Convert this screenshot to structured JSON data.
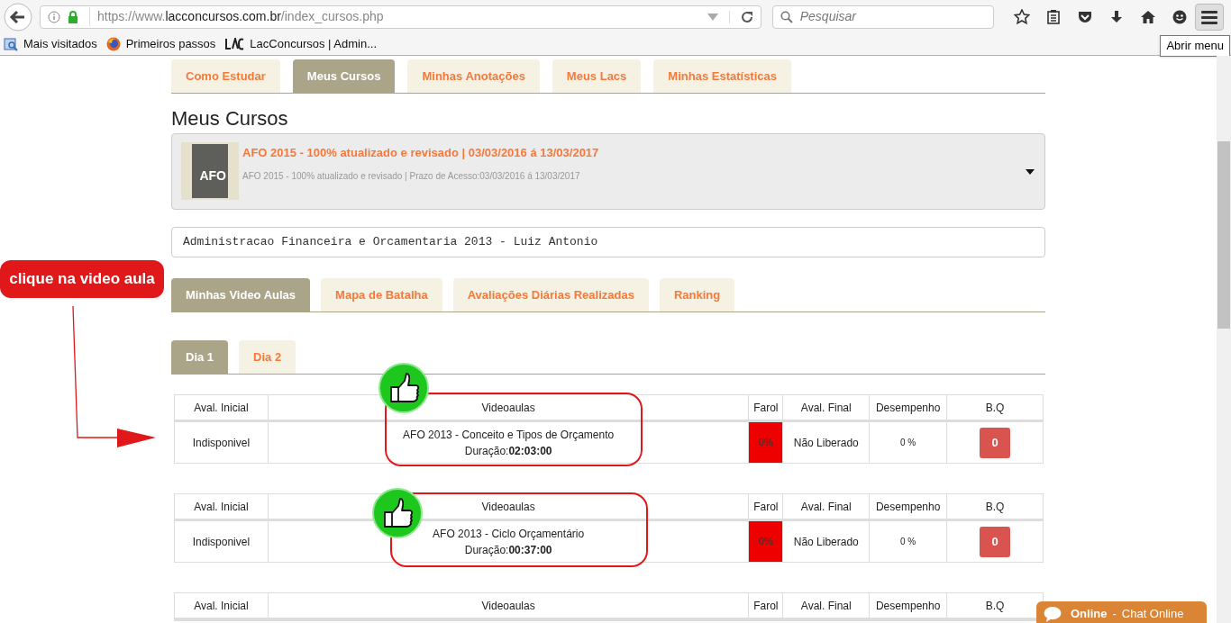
{
  "browser": {
    "url_prefix": "https://www.",
    "url_domain": "lacconcursos.com.br",
    "url_path": "/index_cursos.php",
    "search_placeholder": "Pesquisar",
    "bookmarks": [
      "Mais visitados",
      "Primeiros passos",
      "LacConcursos | Admin..."
    ],
    "tooltip": "Abrir menu"
  },
  "top_tabs": [
    {
      "label": "Como Estudar",
      "selected": false
    },
    {
      "label": "Meus Cursos",
      "selected": true
    },
    {
      "label": "Minhas Anotações",
      "selected": false
    },
    {
      "label": "Meus Lacs",
      "selected": false
    },
    {
      "label": "Minhas Estatísticas",
      "selected": false
    }
  ],
  "page_title": "Meus Cursos",
  "course": {
    "title": "AFO 2015 - 100% atualizado e revisado | 03/03/2016 á 13/03/2017",
    "subtitle": "AFO 2015 - 100% atualizado e revisado | Prazo de Acesso:03/03/2016 á 13/03/2017",
    "cover_text": "AFO"
  },
  "course_select": {
    "value": "Administracao Financeira e Orcamentaria 2013 - Luiz Antonio"
  },
  "section_tabs": [
    {
      "label": "Minhas Video Aulas",
      "selected": true
    },
    {
      "label": "Mapa de Batalha",
      "selected": false
    },
    {
      "label": "Avaliações Diárias Realizadas",
      "selected": false
    },
    {
      "label": "Ranking",
      "selected": false
    }
  ],
  "day_tabs": [
    {
      "label": "Dia 1",
      "selected": true
    },
    {
      "label": "Dia 2",
      "selected": false
    }
  ],
  "tables": [
    {
      "columns": [
        "Aval. Inicial",
        "Videoaulas",
        "Farol",
        "Aval. Final",
        "Desempenho",
        "B.Q"
      ],
      "rows": [
        {
          "aval_inicial": "Indisponivel",
          "video_title": "AFO 2013 - Conceito e Tipos de Orçamento",
          "duration_label": "Duração:",
          "duration": "02:03:00",
          "farol": "0%",
          "color": "#ee0000",
          "aval_final": "Não Liberado",
          "desempenho": "0 %",
          "bq": "0"
        }
      ]
    },
    {
      "columns": [
        "Aval. Inicial",
        "Videoaulas",
        "Farol",
        "Aval. Final",
        "Desempenho",
        "B.Q"
      ],
      "rows": [
        {
          "aval_inicial": "Indisponivel",
          "video_title": "AFO 2013 - Ciclo Orçamentário",
          "duration_label": "Duração:",
          "duration": "00:37:00",
          "farol": "0%",
          "color": "#ee0000",
          "aval_final": "Não Liberado",
          "desempenho": "0 %",
          "bq": "0"
        }
      ]
    },
    {
      "columns": [
        "Aval. Inicial",
        "Videoaulas",
        "Farol",
        "Aval. Final",
        "Desempenho",
        "B.Q"
      ]
    }
  ],
  "annotation": {
    "callout": "clique na video aula"
  },
  "chat": {
    "status": "Online",
    "separator": "-",
    "label": "Chat Online"
  }
}
